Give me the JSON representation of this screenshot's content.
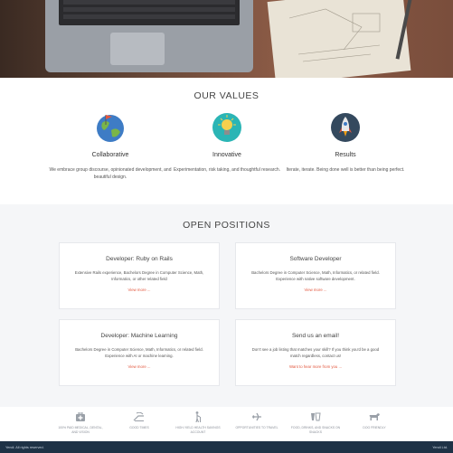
{
  "values": {
    "title": "OUR VALUES",
    "items": [
      {
        "title": "Collaborative",
        "description": "We embrace group discourse, opinionated development, and beautiful design.",
        "icon": "globe-flag-icon"
      },
      {
        "title": "Innovative",
        "description": "Experimentation, risk taking, and thoughtful research.",
        "icon": "lightbulb-icon"
      },
      {
        "title": "Results",
        "description": "Iterate, iterate. Being done well is better than being perfect.",
        "icon": "rocket-icon"
      }
    ]
  },
  "positions": {
    "title": "OPEN POSITIONS",
    "cards": [
      {
        "title": "Developer: Ruby on Rails",
        "description": "Extensive Rails experience, Bachelors Degree in Computer Science, Math, Informatics, or other related field",
        "link": "View more ..."
      },
      {
        "title": "Software Developer",
        "description": "Bachelors Degree in Computer Science, Math, Informatics, or related field. Experience with native software development.",
        "link": "View more ..."
      },
      {
        "title": "Developer: Machine Learning",
        "description": "Bachelors Degree in Computer Science, Math, Informatics, or related field. Experience with AI or machine learning.",
        "link": "View more ..."
      },
      {
        "title": "Send us an email!",
        "description": "Don't see a job listing that matches your skill? If you think you'd be a good match regardless, contact us!",
        "link": "Want to hear more from you ..."
      }
    ]
  },
  "benefits": [
    {
      "label": "100% PAID MEDICAL, DENTAL, AND VISION",
      "icon": "medical-bag-icon"
    },
    {
      "label": "GOOD TIMES",
      "icon": "beach-chair-icon"
    },
    {
      "label": "HIGH-YIELD HEALTH SAVINGS ACCOUNT",
      "icon": "person-cane-icon"
    },
    {
      "label": "OPPORTUNITIES TO TRAVEL",
      "icon": "airplane-icon"
    },
    {
      "label": "FOOD, DRINKS, AND SNACKS ON SNACKS",
      "icon": "food-drinks-icon"
    },
    {
      "label": "DOG FRIENDLY",
      "icon": "dog-icon"
    }
  ],
  "footer": {
    "left": "Yendi. All rights reserved.",
    "right": "Yendi Ltd."
  },
  "colors": {
    "accent": "#e2563d",
    "band": "#f5f6f8",
    "footer": "#1e3246"
  }
}
